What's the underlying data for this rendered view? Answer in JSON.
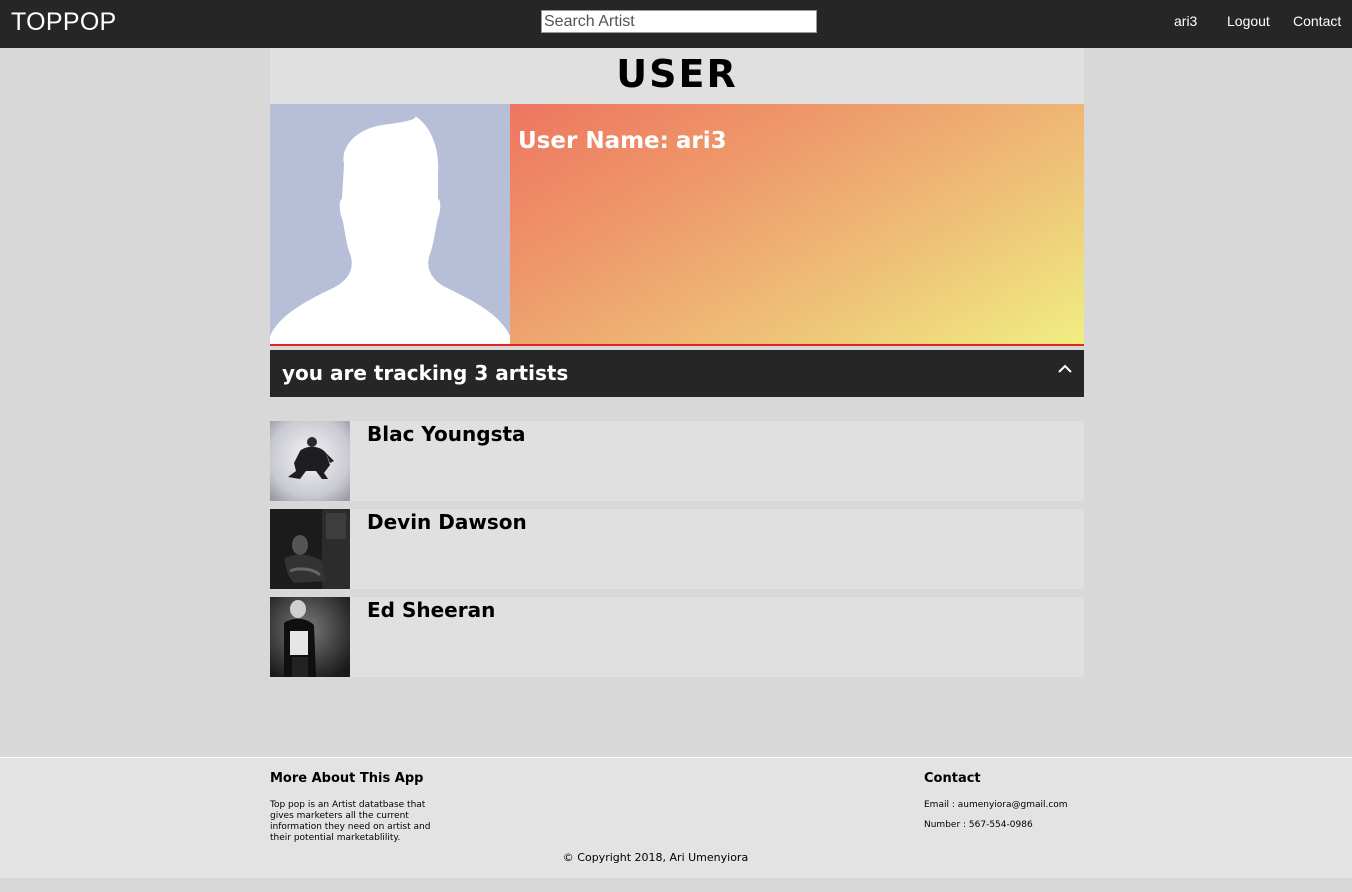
{
  "navbar": {
    "brand": "TOPPOP",
    "search_placeholder": "Search Artist",
    "user_link": "ari3",
    "logout_link": "Logout",
    "contact_link": "Contact"
  },
  "page": {
    "title": "USER"
  },
  "profile": {
    "avatar_icon": "default-avatar-silhouette",
    "user_name_label": "User Name:",
    "user_name": "ari3",
    "gradient_colors": [
      "#ee7560",
      "#f0ee82"
    ]
  },
  "tracking": {
    "summary": "you are tracking 3 artists",
    "toggle_icon": "chevron-up-icon",
    "artists": [
      {
        "name": "Blac Youngsta"
      },
      {
        "name": "Devin Dawson"
      },
      {
        "name": "Ed Sheeran"
      }
    ]
  },
  "footer": {
    "about_heading": "More About This App",
    "about_text": "Top pop is an Artist datatbase that gives marketers all the current information they need on artist and their potential marketablility.",
    "contact_heading": "Contact",
    "email": "Email : aumenyiora@gmail.com",
    "phone": "Number : 567-554-0986",
    "copyright": "© Copyright 2018, Ari Umenyiora"
  },
  "colors": {
    "navbar_bg": "#262626",
    "accent_line": "#e52521",
    "page_bg": "#d8d8d8"
  }
}
